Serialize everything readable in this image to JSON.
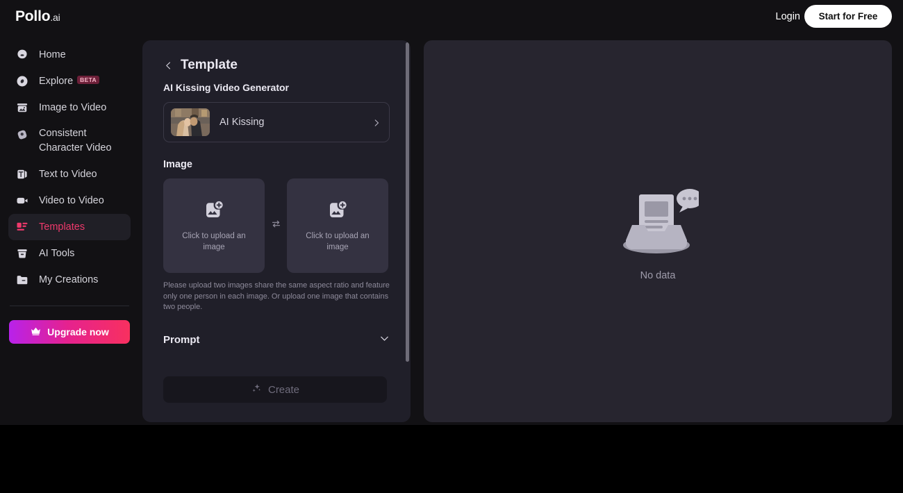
{
  "brand": {
    "name": "Pollo",
    "suffix": ".ai"
  },
  "topbar": {
    "login_label": "Login",
    "start_label": "Start for Free"
  },
  "sidebar": {
    "items": [
      {
        "label": "Home",
        "icon": "home-icon",
        "badge": null,
        "active": false
      },
      {
        "label": "Explore",
        "icon": "compass-icon",
        "badge": "BETA",
        "active": false
      },
      {
        "label": "Image to Video",
        "icon": "image-to-video-icon",
        "badge": null,
        "active": false
      },
      {
        "label": "Consistent Character Video",
        "icon": "character-video-icon",
        "badge": null,
        "active": false
      },
      {
        "label": "Text to Video",
        "icon": "text-to-video-icon",
        "badge": null,
        "active": false
      },
      {
        "label": "Video to Video",
        "icon": "video-to-video-icon",
        "badge": null,
        "active": false
      },
      {
        "label": "Templates",
        "icon": "templates-icon",
        "badge": null,
        "active": true
      },
      {
        "label": "AI Tools",
        "icon": "ai-tools-icon",
        "badge": null,
        "active": false
      },
      {
        "label": "My Creations",
        "icon": "folder-icon",
        "badge": null,
        "active": false
      }
    ],
    "upgrade_label": "Upgrade now",
    "upgrade_icon": "crown-icon"
  },
  "form_panel": {
    "back_icon": "chevron-left-icon",
    "title": "Template",
    "generator_caption": "AI Kissing Video Generator",
    "template_row": {
      "name": "AI Kissing",
      "chevron_icon": "chevron-right-icon",
      "thumbnail": "ai-kissing-thumbnail"
    },
    "image_label": "Image",
    "upload_left": {
      "caption": "Click to upload an image",
      "icon": "image-add-icon"
    },
    "upload_right": {
      "caption": "Click to upload an image",
      "icon": "image-add-icon"
    },
    "swap_icon": "swap-arrows-icon",
    "hint": "Please upload two images share the same aspect ratio and feature only one person in each image. Or upload one image that contains two people.",
    "prompt_label": "Prompt",
    "prompt_chevron_icon": "chevron-down-icon",
    "create_label": "Create",
    "create_icon": "sparkles-icon",
    "create_disabled": true
  },
  "preview_panel": {
    "empty_icon": "empty-inbox-icon",
    "empty_text": "No data"
  },
  "colors": {
    "accent_pink": "#f0396c",
    "upgrade_gradient_start": "#b822ea",
    "upgrade_gradient_end": "#f8305f",
    "panel_bg": "#201f29",
    "preview_bg": "#27252f",
    "app_bg": "#121114",
    "page_bg": "#000000"
  }
}
